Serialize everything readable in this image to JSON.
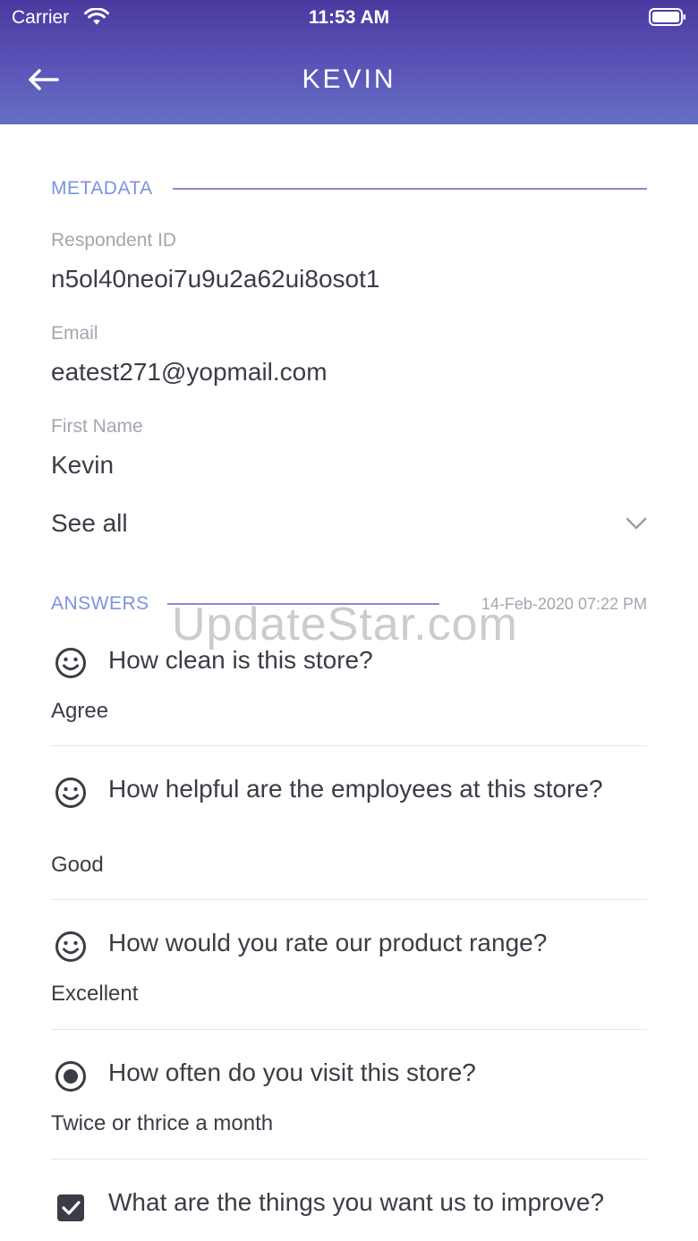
{
  "status_bar": {
    "carrier": "Carrier",
    "time": "11:53 AM",
    "wifi_icon": "wifi-icon",
    "battery_icon": "battery-icon"
  },
  "nav": {
    "title": "KEVIN",
    "back_icon": "arrow-left-icon"
  },
  "metadata": {
    "section_label": "METADATA",
    "fields": [
      {
        "label": "Respondent ID",
        "value": "n5ol40neoi7u9u2a62ui8osot1"
      },
      {
        "label": "Email",
        "value": "eatest271@yopmail.com"
      },
      {
        "label": "First Name",
        "value": "Kevin"
      }
    ],
    "see_all_label": "See all"
  },
  "answers": {
    "section_label": "ANSWERS",
    "date": "14-Feb-2020 07:22 PM",
    "items": [
      {
        "icon": "smiley-icon",
        "question": "How clean is this store?",
        "answer": "Agree"
      },
      {
        "icon": "smiley-icon",
        "question": "How helpful are the employees at this store?",
        "answer": "Good"
      },
      {
        "icon": "smiley-icon",
        "question": "How would you rate our product range?",
        "answer": "Excellent"
      },
      {
        "icon": "radio-icon",
        "question": "How often do you visit this store?",
        "answer": "Twice or thrice a month"
      },
      {
        "icon": "checkbox-icon",
        "question": "What are the things you want us to improve?",
        "answer": ""
      }
    ]
  },
  "watermark": "UpdateStar.com",
  "colors": {
    "header_top": "#4a3aa0",
    "header_bottom": "#6570c4",
    "section_label": "#7d92e2",
    "section_line": "#8f86d8"
  }
}
